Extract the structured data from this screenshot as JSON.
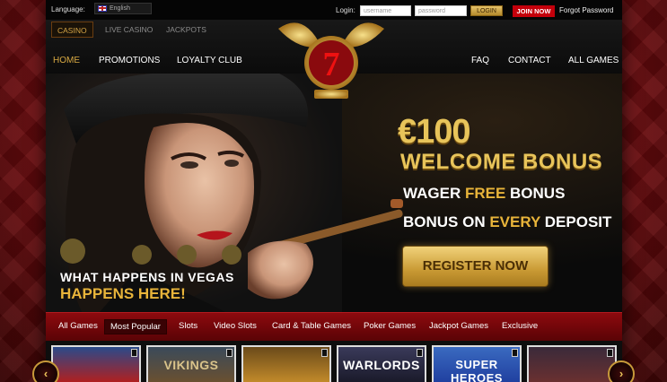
{
  "topbar": {
    "language_label": "Language:",
    "language_value": "English",
    "login_label": "Login:",
    "username_placeholder": "username",
    "password_placeholder": "password",
    "login_button": "LOGIN",
    "join_button": "JOIN NOW",
    "forgot_password": "Forgot Password"
  },
  "subtabs": [
    "CASINO",
    "LIVE CASINO",
    "JACKPOTS"
  ],
  "nav_left": [
    "HOME",
    "PROMOTIONS",
    "LOYALTY CLUB"
  ],
  "nav_right": [
    "FAQ",
    "CONTACT",
    "ALL GAMES"
  ],
  "hero": {
    "amount": "€100",
    "headline": "WELCOME BONUS",
    "line1_a": "WAGER ",
    "line1_b": "FREE",
    "line1_c": " BONUS",
    "line2_a": "BONUS ON ",
    "line2_b": "EVERY",
    "line2_c": " DEPOSIT",
    "register": "REGISTER NOW",
    "tagline1": "WHAT HAPPENS IN VEGAS",
    "tagline2": "HAPPENS HERE!"
  },
  "categories": [
    "All Games",
    "Most Popular",
    "Slots",
    "Video Slots",
    "Card & Table Games",
    "Poker Games",
    "Jackpot Games",
    "Exclusive"
  ],
  "games": [
    "",
    "VIKINGS",
    "",
    "WARLORDS",
    "SUPER HEROES",
    ""
  ],
  "colors": {
    "gold": "#e8c45a",
    "red": "#c4000b",
    "bar": "#8d0a0e"
  }
}
